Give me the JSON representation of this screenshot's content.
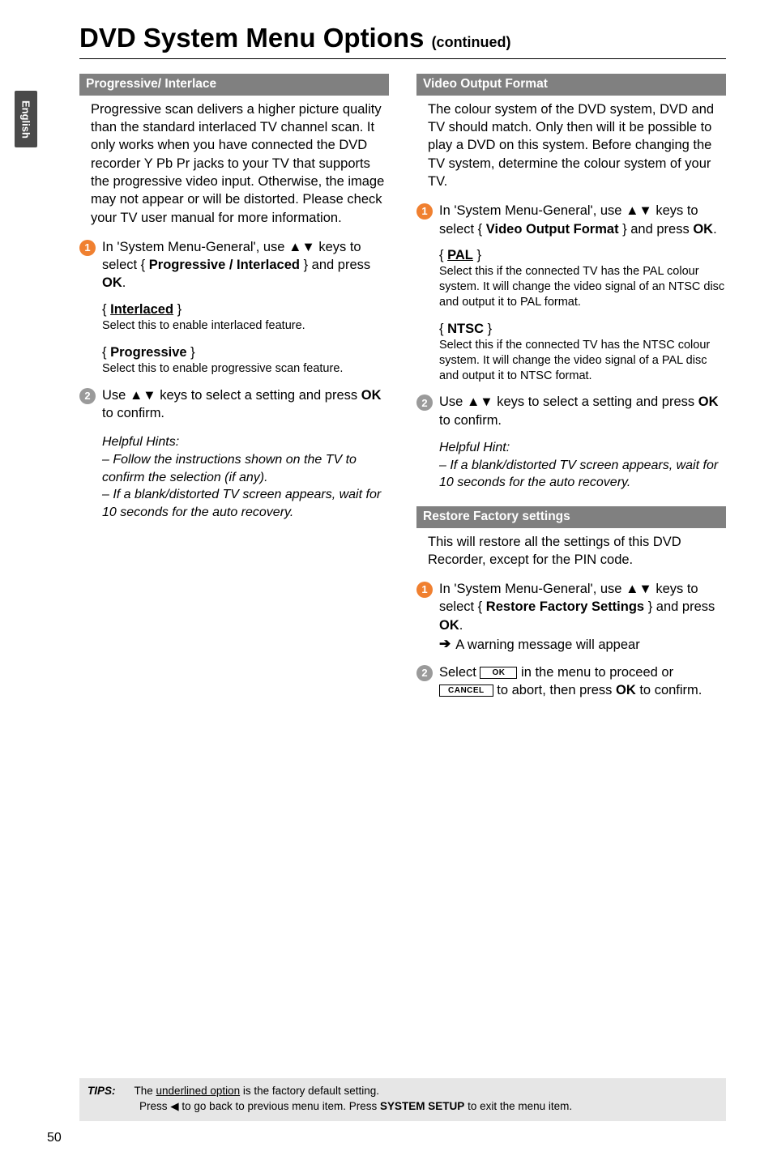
{
  "lang_tab": "English",
  "title_main": "DVD System Menu Options ",
  "title_sub": "(continued)",
  "icons": {
    "up_down": "▲▼",
    "left": "◀",
    "right_arrow": "➔"
  },
  "left": {
    "head": "Progressive/ Interlace",
    "intro": "Progressive scan delivers a higher picture quality than the standard interlaced TV channel scan. It only works when you have connected the DVD recorder Y Pb Pr jacks to your TV that supports the progressive video input. Otherwise, the image may not appear or will be distorted. Please check your TV user manual for more information.",
    "step1_a": "In 'System Menu-General', use ",
    "step1_b": " keys to select { ",
    "step1_c": "Progressive / Interlaced",
    "step1_d": " } and press ",
    "step1_e": "OK",
    "step1_f": ".",
    "opt1_head_a": "{ ",
    "opt1_head_b": "Interlaced",
    "opt1_head_c": " }",
    "opt1_desc": "Select this to enable interlaced feature.",
    "opt2_head_a": "{ ",
    "opt2_head_b": "Progressive",
    "opt2_head_c": " }",
    "opt2_desc": "Select this to enable progressive scan feature.",
    "step2_a": "Use ",
    "step2_b": " keys to select a setting and press ",
    "step2_c": "OK",
    "step2_d": " to confirm.",
    "hints_head": "Helpful Hints:",
    "hints_1": "–  Follow the instructions shown on the TV to confirm the selection (if any).",
    "hints_2": "–  If a blank/distorted TV screen appears, wait for 10 seconds for the auto recovery."
  },
  "right": {
    "head1": "Video Output Format",
    "intro1": "The colour system of the DVD system, DVD and TV should match. Only then will it be possible to play a DVD on this system. Before changing the TV system, determine the colour system of your TV.",
    "s1_a": "In 'System Menu-General', use ",
    "s1_b": " keys to select { ",
    "s1_c": "Video Output Format",
    "s1_d": " } and press ",
    "s1_e": "OK",
    "s1_f": ".",
    "pal_h_a": "{ ",
    "pal_h_b": "PAL",
    "pal_h_c": " }",
    "pal_d": "Select this if the connected TV has the PAL colour system. It will change the video signal of an NTSC disc and output it to PAL format.",
    "ntsc_h_a": "{ ",
    "ntsc_h_b": "NTSC",
    "ntsc_h_c": " }",
    "ntsc_d": "Select this if the connected TV has the NTSC colour system. It will change the video signal of a PAL disc and output it to NTSC format.",
    "s2_a": "Use ",
    "s2_b": " keys to select a setting and press ",
    "s2_c": "OK",
    "s2_d": " to confirm.",
    "hint_head": "Helpful Hint:",
    "hint_1": "– If a blank/distorted TV screen appears, wait for 10 seconds for the auto recovery.",
    "head2": "Restore Factory settings",
    "intro2": "This will restore all the settings of this DVD Recorder, except for the PIN code.",
    "r1_a": "In 'System Menu-General', use ",
    "r1_b": " keys to select { ",
    "r1_c": "Restore Factory Settings",
    "r1_d": " } and press ",
    "r1_e": "OK",
    "r1_f": ".",
    "r1_sub": "A warning message will appear",
    "r2_a": "Select ",
    "r2_ok": "OK",
    "r2_b": " in the menu to proceed or ",
    "r2_cancel": "CANCEL",
    "r2_c": " to abort, then press ",
    "r2_d": "OK",
    "r2_e": " to confirm."
  },
  "tips": {
    "label": "TIPS:",
    "line1_a": "The ",
    "line1_b": "underlined option",
    "line1_c": " is the factory default setting.",
    "line2_a": "Press ",
    "line2_b": " to go back to previous menu item. Press ",
    "line2_c": "SYSTEM SETUP",
    "line2_d": " to exit the menu item."
  },
  "page_num": "50"
}
